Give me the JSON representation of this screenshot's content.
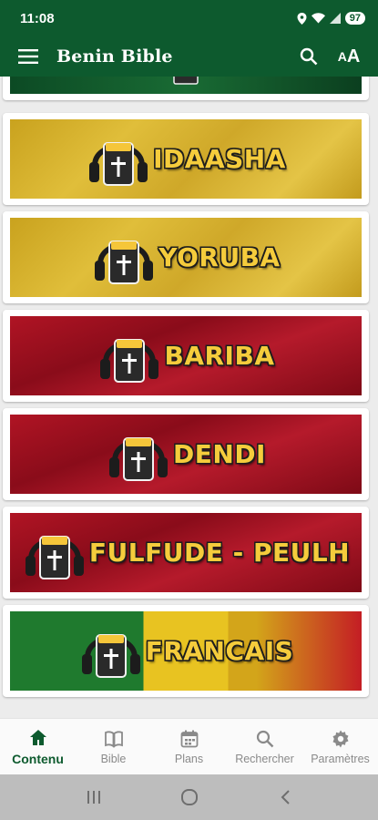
{
  "status_bar": {
    "time": "11:08",
    "battery": "97"
  },
  "app_bar": {
    "title": "Benin Bible",
    "font_label_small": "A",
    "font_label_large": "A"
  },
  "colors": {
    "primary": "#0d5a2e",
    "label": "#f5cc3c",
    "gold": "#d8b532",
    "red": "#a3121f"
  },
  "languages": [
    {
      "label": "IDAASHA",
      "theme": "gold"
    },
    {
      "label": "YORUBA",
      "theme": "gold"
    },
    {
      "label": "BARIBA",
      "theme": "red"
    },
    {
      "label": "DENDI",
      "theme": "red"
    },
    {
      "label": "FULFUDE - PEULH",
      "theme": "red"
    },
    {
      "label": "FRANCAIS",
      "theme": "flag"
    }
  ],
  "bottom_nav": [
    {
      "label": "Contenu",
      "icon": "home-icon",
      "active": true
    },
    {
      "label": "Bible",
      "icon": "book-icon",
      "active": false
    },
    {
      "label": "Plans",
      "icon": "calendar-icon",
      "active": false
    },
    {
      "label": "Rechercher",
      "icon": "search-icon",
      "active": false
    },
    {
      "label": "Paramètres",
      "icon": "gear-icon",
      "active": false
    }
  ]
}
